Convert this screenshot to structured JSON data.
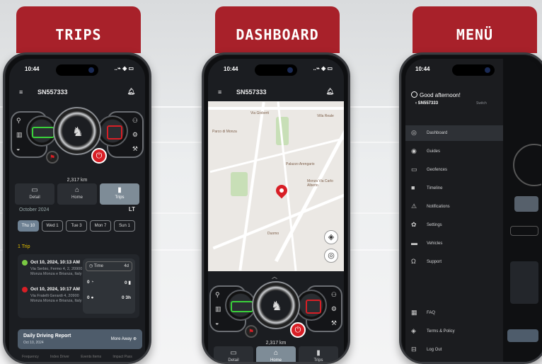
{
  "labels": {
    "trips": "TRIPS",
    "dashboard": "DASHBOARD",
    "menu": "MENÜ"
  },
  "status": {
    "time": "10:44",
    "signal": "..⌁ ◈ ▭"
  },
  "device": {
    "plate": "SN557333"
  },
  "cluster": {
    "km": "2,317 km"
  },
  "nav": {
    "left": "Detail",
    "home": "Home",
    "trips": "Trips"
  },
  "trips": {
    "month": "October 2024",
    "lt_label": "LT",
    "days": [
      "Thu 10",
      "Wed 1",
      "Tue 3",
      "Mon 7",
      "Sun 1"
    ],
    "section_label": "1 Trip",
    "start_time": "Oct 10, 2024, 10:13 AM",
    "start_addr": "Via Serbio, Fermo 4, 2, 20900 Monza Monza e Brianza, Italy",
    "end_time": "Oct 10, 2024, 10:17 AM",
    "end_addr": "Via Fratelli Gerardi 4, 20900 Monza Monza e Brianza, Italy",
    "stat_time": "Time",
    "stat_time_val": "4d",
    "stat_row1_a": "0",
    "stat_row1_b": "0",
    "stat_row2_a": "0",
    "stat_row2_b": "0 3h",
    "report_title": "Daily Driving Report",
    "report_date": "Oct 10, 2024",
    "report_more": "More Away ⊕",
    "footer": [
      "Frequency",
      "Index Driver",
      "Events Items",
      "Impact Pass"
    ]
  },
  "map": {
    "labels": [
      "Via Gioberti",
      "Villa Reale",
      "Parco di Monza",
      "Monza Via Carlo Alberto",
      "Palazzo Arengario",
      "Duomo"
    ]
  },
  "menu": {
    "greeting": "Good afternoon!",
    "plate": "SN557333",
    "switch": "Switch",
    "items": [
      {
        "label": "Dashboard",
        "icon": "◎"
      },
      {
        "label": "Guides",
        "icon": "◉"
      },
      {
        "label": "Geofences",
        "icon": "▭"
      },
      {
        "label": "Timeline",
        "icon": "■"
      },
      {
        "label": "Notifications",
        "icon": "⚠"
      },
      {
        "label": "Settings",
        "icon": "✿"
      },
      {
        "label": "Vehicles",
        "icon": "▬"
      },
      {
        "label": "Support",
        "icon": "Ω"
      }
    ],
    "bottom": [
      {
        "label": "FAQ",
        "icon": "▦"
      },
      {
        "label": "Terms & Policy",
        "icon": "◈"
      },
      {
        "label": "Log Out",
        "icon": "⊟"
      }
    ]
  }
}
